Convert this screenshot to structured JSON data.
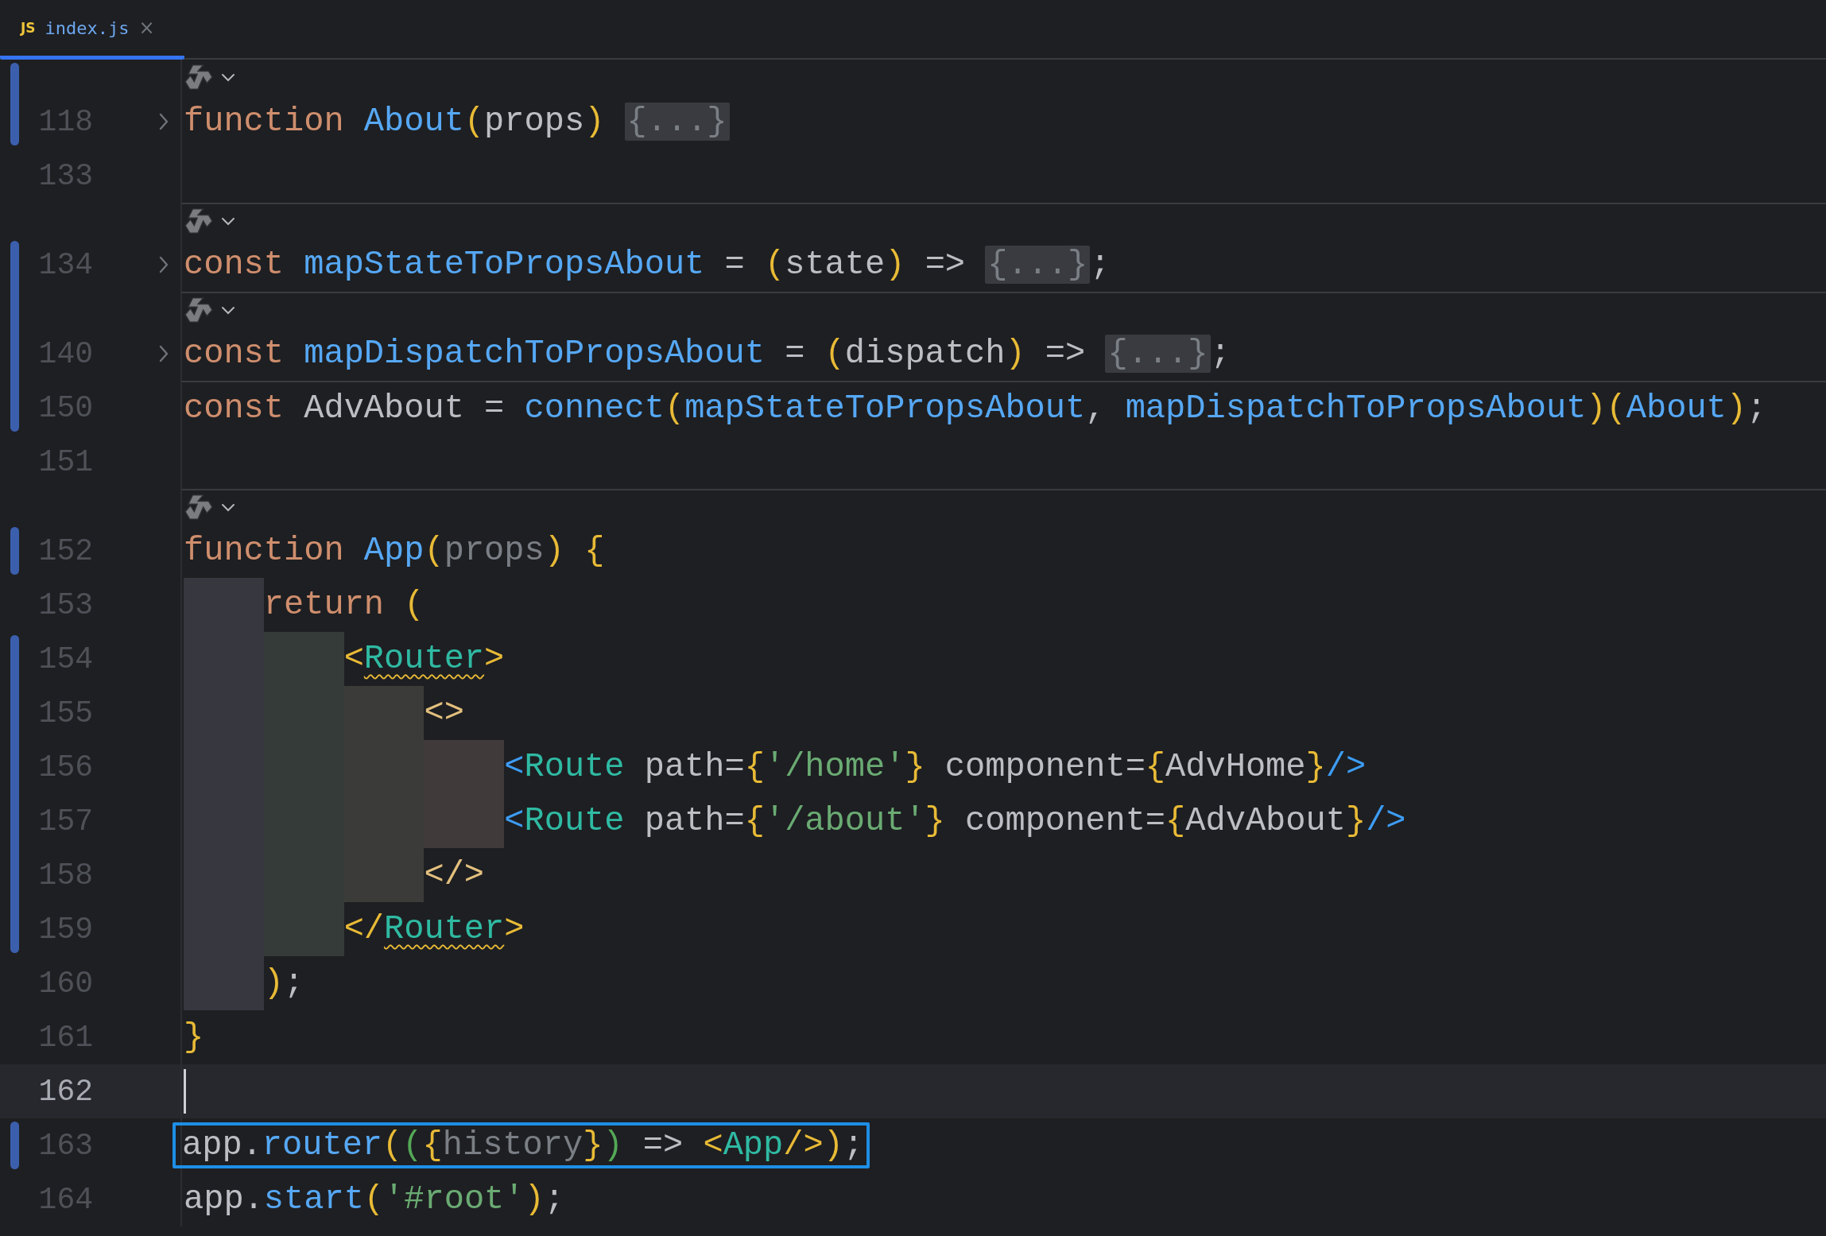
{
  "tab": {
    "icon_text": "JS",
    "label": "index.js",
    "close": "×",
    "selected": true
  },
  "rows": [
    {
      "kind": "inlay",
      "separator": false,
      "changed": true
    },
    {
      "kind": "line",
      "number": "118",
      "separator": false,
      "changed": true,
      "folded": true,
      "tokens": [
        {
          "kind": "kw",
          "t": "function "
        },
        {
          "kind": "fn",
          "t": "About"
        },
        {
          "kind": "y",
          "t": "("
        },
        {
          "kind": "plain",
          "t": "props"
        },
        {
          "kind": "y",
          "t": ") "
        },
        {
          "kind": "fold",
          "t": "{...}"
        }
      ]
    },
    {
      "kind": "line",
      "number": "133",
      "separator": false,
      "changed": false,
      "folded": false,
      "tokens": []
    },
    {
      "kind": "inlay",
      "separator": true,
      "changed": false
    },
    {
      "kind": "line",
      "number": "134",
      "separator": false,
      "changed": true,
      "folded": true,
      "tokens": [
        {
          "kind": "kw",
          "t": "const "
        },
        {
          "kind": "fn",
          "t": "mapStateToPropsAbout"
        },
        {
          "kind": "plain",
          "t": " = "
        },
        {
          "kind": "y",
          "t": "("
        },
        {
          "kind": "plain",
          "t": "state"
        },
        {
          "kind": "y",
          "t": ")"
        },
        {
          "kind": "plain",
          "t": " => "
        },
        {
          "kind": "fold",
          "t": "{...}"
        },
        {
          "kind": "plain",
          "t": ";"
        }
      ]
    },
    {
      "kind": "inlay",
      "separator": true,
      "changed": true
    },
    {
      "kind": "line",
      "number": "140",
      "separator": false,
      "changed": true,
      "folded": true,
      "tokens": [
        {
          "kind": "kw",
          "t": "const "
        },
        {
          "kind": "fn",
          "t": "mapDispatchToPropsAbout"
        },
        {
          "kind": "plain",
          "t": " = "
        },
        {
          "kind": "y",
          "t": "("
        },
        {
          "kind": "plain",
          "t": "dispatch"
        },
        {
          "kind": "y",
          "t": ")"
        },
        {
          "kind": "plain",
          "t": " => "
        },
        {
          "kind": "fold",
          "t": "{...}"
        },
        {
          "kind": "plain",
          "t": ";"
        }
      ]
    },
    {
      "kind": "line",
      "number": "150",
      "separator": true,
      "changed": true,
      "folded": false,
      "tokens": [
        {
          "kind": "kw",
          "t": "const"
        },
        {
          "kind": "plain",
          "t": " AdvAbout = "
        },
        {
          "kind": "fn",
          "t": "connect"
        },
        {
          "kind": "y",
          "t": "("
        },
        {
          "kind": "fn",
          "t": "mapStateToPropsAbout"
        },
        {
          "kind": "plain",
          "t": ", "
        },
        {
          "kind": "fn",
          "t": "mapDispatchToPropsAbout"
        },
        {
          "kind": "y",
          "t": ")("
        },
        {
          "kind": "fn",
          "t": "About"
        },
        {
          "kind": "y",
          "t": ")"
        },
        {
          "kind": "plain",
          "t": ";"
        }
      ]
    },
    {
      "kind": "line",
      "number": "151",
      "separator": false,
      "changed": false,
      "folded": false,
      "tokens": []
    },
    {
      "kind": "inlay",
      "separator": true,
      "changed": false
    },
    {
      "kind": "line",
      "number": "152",
      "separator": false,
      "changed": true,
      "folded": false,
      "tokens": [
        {
          "kind": "kw",
          "t": "function "
        },
        {
          "kind": "fn",
          "t": "App"
        },
        {
          "kind": "y",
          "t": "("
        },
        {
          "kind": "dim",
          "t": "props"
        },
        {
          "kind": "y",
          "t": ") {"
        }
      ]
    },
    {
      "kind": "line",
      "number": "153",
      "separator": false,
      "changed": false,
      "folded": false,
      "guides": [
        {
          "color": "#37373f"
        }
      ],
      "tokens": [
        {
          "kind": "kw",
          "t": "return "
        },
        {
          "kind": "y",
          "t": "("
        }
      ]
    },
    {
      "kind": "line",
      "number": "154",
      "separator": false,
      "changed": true,
      "folded": false,
      "guides": [
        {
          "color": "#37373f"
        },
        {
          "color": "#343b39"
        }
      ],
      "tokens": [
        {
          "kind": "y",
          "t": "<"
        },
        {
          "kind": "tagw",
          "t": "Router"
        },
        {
          "kind": "y",
          "t": ">"
        }
      ]
    },
    {
      "kind": "line",
      "number": "155",
      "separator": false,
      "changed": true,
      "folded": false,
      "guides": [
        {
          "color": "#37373f"
        },
        {
          "color": "#343b39"
        },
        {
          "color": "#3b3c39"
        }
      ],
      "tokens": [
        {
          "kind": "frag",
          "t": "<>"
        }
      ]
    },
    {
      "kind": "line",
      "number": "156",
      "separator": false,
      "changed": true,
      "folded": false,
      "guides": [
        {
          "color": "#37373f"
        },
        {
          "color": "#343b39"
        },
        {
          "color": "#3b3c39"
        },
        {
          "color": "#403a3a"
        }
      ],
      "tokens": [
        {
          "kind": "b",
          "t": "<"
        },
        {
          "kind": "tag",
          "t": "Route"
        },
        {
          "kind": "plain",
          "t": " path="
        },
        {
          "kind": "y",
          "t": "{"
        },
        {
          "kind": "str",
          "t": "'/home'"
        },
        {
          "kind": "y",
          "t": "}"
        },
        {
          "kind": "plain",
          "t": " component="
        },
        {
          "kind": "y",
          "t": "{"
        },
        {
          "kind": "plain",
          "t": "AdvHome"
        },
        {
          "kind": "y",
          "t": "}"
        },
        {
          "kind": "b",
          "t": "/>"
        }
      ]
    },
    {
      "kind": "line",
      "number": "157",
      "separator": false,
      "changed": true,
      "folded": false,
      "guides": [
        {
          "color": "#37373f"
        },
        {
          "color": "#343b39"
        },
        {
          "color": "#3b3c39"
        },
        {
          "color": "#403a3a"
        }
      ],
      "tokens": [
        {
          "kind": "b",
          "t": "<"
        },
        {
          "kind": "tag",
          "t": "Route"
        },
        {
          "kind": "plain",
          "t": " path="
        },
        {
          "kind": "y",
          "t": "{"
        },
        {
          "kind": "str",
          "t": "'/about'"
        },
        {
          "kind": "y",
          "t": "}"
        },
        {
          "kind": "plain",
          "t": " component="
        },
        {
          "kind": "y",
          "t": "{"
        },
        {
          "kind": "plain",
          "t": "AdvAbout"
        },
        {
          "kind": "y",
          "t": "}"
        },
        {
          "kind": "b",
          "t": "/>"
        }
      ]
    },
    {
      "kind": "line",
      "number": "158",
      "separator": false,
      "changed": true,
      "folded": false,
      "guides": [
        {
          "color": "#37373f"
        },
        {
          "color": "#343b39"
        },
        {
          "color": "#3b3c39"
        }
      ],
      "tokens": [
        {
          "kind": "frag",
          "t": "</>"
        }
      ]
    },
    {
      "kind": "line",
      "number": "159",
      "separator": false,
      "changed": true,
      "folded": false,
      "guides": [
        {
          "color": "#37373f"
        },
        {
          "color": "#343b39"
        }
      ],
      "tokens": [
        {
          "kind": "y",
          "t": "</"
        },
        {
          "kind": "tagw",
          "t": "Router"
        },
        {
          "kind": "y",
          "t": ">"
        }
      ]
    },
    {
      "kind": "line",
      "number": "160",
      "separator": false,
      "changed": false,
      "folded": false,
      "guides": [
        {
          "color": "#37373f"
        }
      ],
      "tokens": [
        {
          "kind": "y",
          "t": ")"
        },
        {
          "kind": "plain",
          "t": ";"
        }
      ]
    },
    {
      "kind": "line",
      "number": "161",
      "separator": false,
      "changed": false,
      "folded": false,
      "tokens": [
        {
          "kind": "y",
          "t": "}"
        }
      ]
    },
    {
      "kind": "line",
      "number": "162",
      "separator": false,
      "changed": false,
      "folded": false,
      "current": true,
      "tokens": []
    },
    {
      "kind": "line",
      "number": "163",
      "separator": false,
      "changed": true,
      "folded": false,
      "boxed": true,
      "tokens": [
        {
          "kind": "plain",
          "t": "app."
        },
        {
          "kind": "fn",
          "t": "router"
        },
        {
          "kind": "y",
          "t": "("
        },
        {
          "kind": "g",
          "t": "("
        },
        {
          "kind": "y",
          "t": "{"
        },
        {
          "kind": "dim",
          "t": "history"
        },
        {
          "kind": "y",
          "t": "}"
        },
        {
          "kind": "g",
          "t": ")"
        },
        {
          "kind": "plain",
          "t": " => "
        },
        {
          "kind": "y",
          "t": "<"
        },
        {
          "kind": "tag",
          "t": "App"
        },
        {
          "kind": "y",
          "t": "/>)"
        },
        {
          "kind": "plain",
          "t": ";"
        }
      ]
    },
    {
      "kind": "line",
      "number": "164",
      "separator": false,
      "changed": false,
      "folded": false,
      "tokens": [
        {
          "kind": "plain",
          "t": "app."
        },
        {
          "kind": "fn",
          "t": "start"
        },
        {
          "kind": "y",
          "t": "("
        },
        {
          "kind": "str",
          "t": "'#root'"
        },
        {
          "kind": "y",
          "t": ")"
        },
        {
          "kind": "plain",
          "t": ";"
        }
      ]
    }
  ]
}
